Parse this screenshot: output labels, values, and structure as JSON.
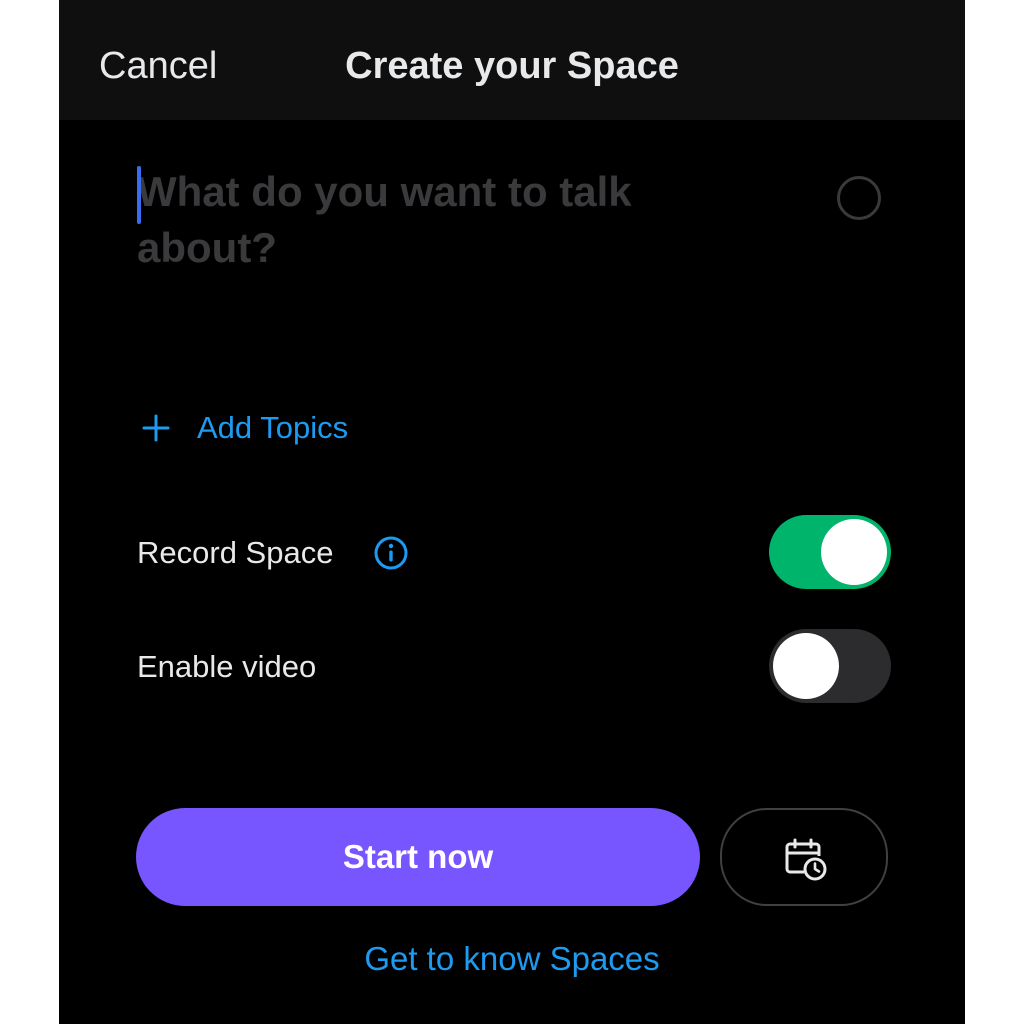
{
  "header": {
    "cancel_label": "Cancel",
    "title": "Create your Space"
  },
  "compose": {
    "placeholder": "What do you want to talk about?",
    "value": ""
  },
  "topics": {
    "add_label": "Add Topics",
    "icon": "plus-icon"
  },
  "settings": {
    "record_space": {
      "label": "Record Space",
      "icon": "info-icon",
      "enabled": true
    },
    "enable_video": {
      "label": "Enable video",
      "enabled": false
    }
  },
  "actions": {
    "start_label": "Start now",
    "schedule_icon": "calendar-clock-icon",
    "learn_link": "Get to know Spaces"
  },
  "colors": {
    "accent_blue": "#1d9bf0",
    "primary_button": "#7856ff",
    "toggle_on": "#00b46c",
    "toggle_off": "#2c2c2e",
    "background": "#000000",
    "header_background": "#0f0f10"
  }
}
